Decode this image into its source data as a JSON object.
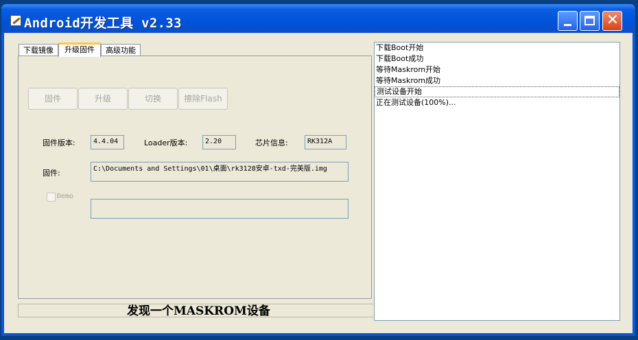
{
  "window": {
    "title": "Android开发工具 v2.33"
  },
  "tabs": [
    {
      "label": "下载镜像"
    },
    {
      "label": "升级固件"
    },
    {
      "label": "高级功能"
    }
  ],
  "buttons": {
    "firmware": "固件",
    "upgrade": "升级",
    "switch": "切换",
    "erase_flash": "擦除Flash"
  },
  "info": {
    "firmware_version_label": "固件版本:",
    "firmware_version": "4.4.04",
    "loader_version_label": "Loader版本:",
    "loader_version": "2.20",
    "chip_info_label": "芯片信息:",
    "chip_info": "RK312A",
    "firmware_label": "固件:",
    "firmware_path": "C:\\Documents and Settings\\01\\桌面\\rk3128安卓-txd-完美版.img",
    "demo_label": "Demo",
    "demo_path": ""
  },
  "status": {
    "text": "发现一个MASKROM设备"
  },
  "log": [
    "下载Boot开始",
    "下载Boot成功",
    "等待Maskrom开始",
    "等待Maskrom成功",
    "测试设备开始",
    "正在测试设备(100%)..."
  ]
}
